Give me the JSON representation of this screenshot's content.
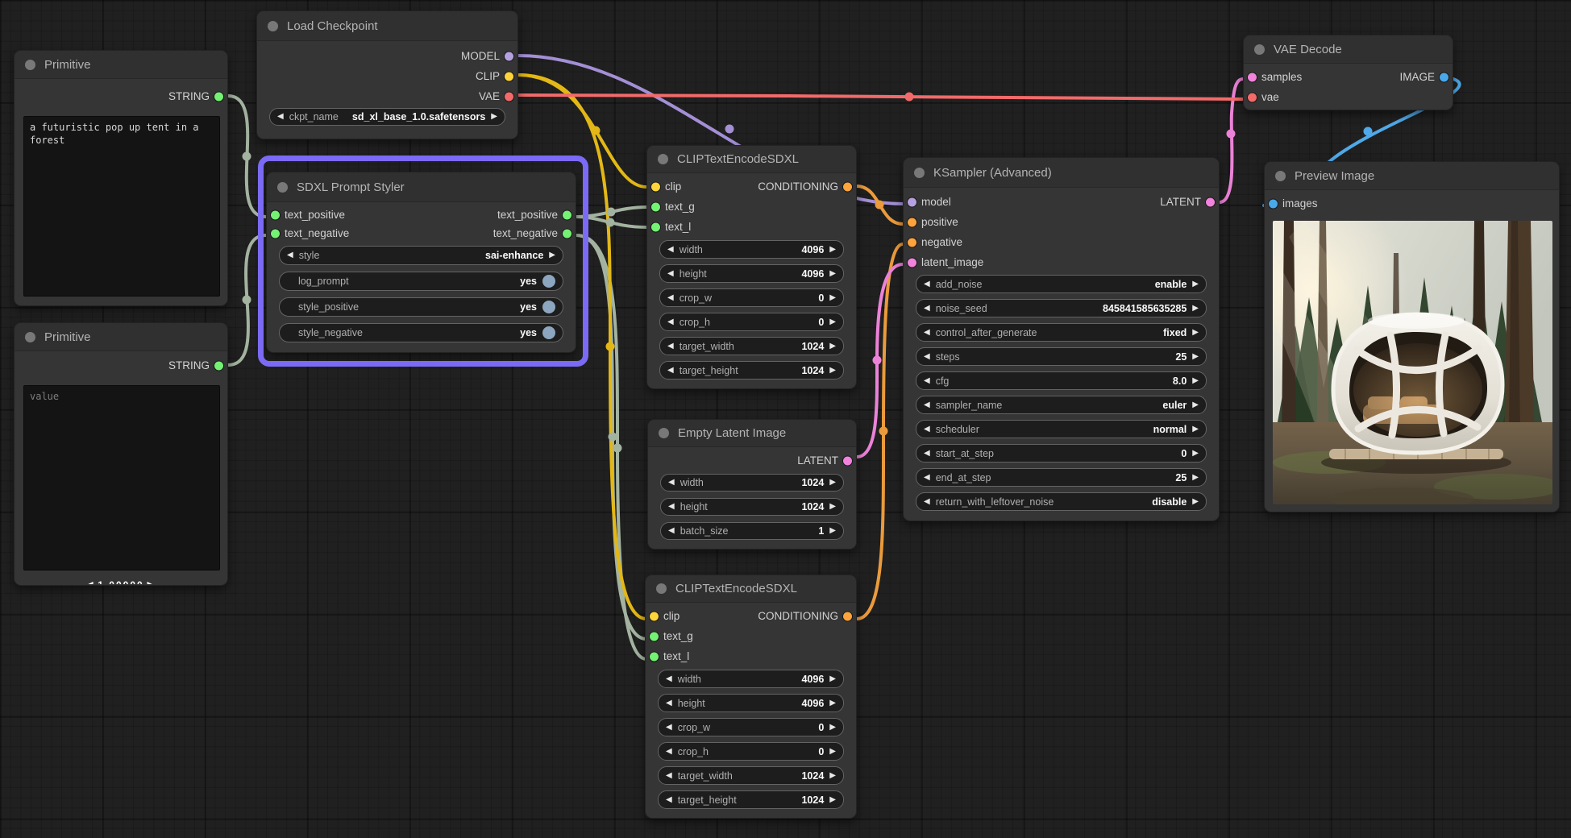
{
  "palette": {
    "green": "#74f274",
    "yellow": "#ffd43b",
    "purple": "#b6a1e0",
    "red": "#f36a6a",
    "orange": "#ffa43d",
    "pink": "#f183dd",
    "blue": "#4aa7e8",
    "wire_string": "#a3b3a0",
    "wire_clip": "#e3b816",
    "wire_model": "#a48fd6",
    "wire_vae": "#f36a6a",
    "wire_cond": "#eb9b3c",
    "wire_latent": "#ec82d8",
    "wire_image": "#4fa9e8",
    "selection": "#7b6af5",
    "toggle": "#8da6bf"
  },
  "nodes": [
    {
      "id": "primitive-1",
      "title": "Primitive",
      "rows": [
        {
          "out": {
            "name": "STRING",
            "color": "green"
          }
        }
      ],
      "text": {
        "value": "a futuristic pop up tent in a forest"
      }
    },
    {
      "id": "load-checkpoint",
      "title": "Load Checkpoint",
      "rows": [
        {
          "out": {
            "name": "MODEL",
            "color": "purple"
          }
        },
        {
          "out": {
            "name": "CLIP",
            "color": "yellow"
          }
        },
        {
          "out": {
            "name": "VAE",
            "color": "red"
          }
        }
      ],
      "widgets": [
        {
          "kind": "combo",
          "label": "ckpt_name",
          "value": "sd_xl_base_1.0.safetensors"
        }
      ]
    },
    {
      "id": "sdxl-prompt-styler",
      "title": "SDXL Prompt Styler",
      "selected": true,
      "rows": [
        {
          "in": {
            "name": "text_positive",
            "color": "green"
          },
          "out": {
            "name": "text_positive",
            "color": "green"
          }
        },
        {
          "in": {
            "name": "text_negative",
            "color": "green"
          },
          "out": {
            "name": "text_negative",
            "color": "green"
          }
        }
      ],
      "widgets": [
        {
          "kind": "combo",
          "label": "style",
          "value": "sai-enhance"
        },
        {
          "kind": "toggle",
          "label": "log_prompt",
          "value": "yes"
        },
        {
          "kind": "toggle",
          "label": "style_positive",
          "value": "yes"
        },
        {
          "kind": "toggle",
          "label": "style_negative",
          "value": "yes"
        }
      ]
    },
    {
      "id": "primitive-2",
      "title": "Primitive",
      "rows": [
        {
          "out": {
            "name": "STRING",
            "color": "green"
          }
        }
      ],
      "text": {
        "value": "",
        "placeholder": "value"
      }
    },
    {
      "id": "clip-encode-top",
      "title": "CLIPTextEncodeSDXL",
      "rows": [
        {
          "in": {
            "name": "clip",
            "color": "yellow"
          },
          "out": {
            "name": "CONDITIONING",
            "color": "orange"
          }
        },
        {
          "in": {
            "name": "text_g",
            "color": "green"
          }
        },
        {
          "in": {
            "name": "text_l",
            "color": "green"
          }
        }
      ],
      "widgets": [
        {
          "kind": "combo",
          "label": "width",
          "value": "4096"
        },
        {
          "kind": "combo",
          "label": "height",
          "value": "4096"
        },
        {
          "kind": "combo",
          "label": "crop_w",
          "value": "0"
        },
        {
          "kind": "combo",
          "label": "crop_h",
          "value": "0"
        },
        {
          "kind": "combo",
          "label": "target_width",
          "value": "1024"
        },
        {
          "kind": "combo",
          "label": "target_height",
          "value": "1024"
        }
      ]
    },
    {
      "id": "empty-latent",
      "title": "Empty Latent Image",
      "rows": [
        {
          "out": {
            "name": "LATENT",
            "color": "pink"
          }
        }
      ],
      "widgets": [
        {
          "kind": "combo",
          "label": "width",
          "value": "1024"
        },
        {
          "kind": "combo",
          "label": "height",
          "value": "1024"
        },
        {
          "kind": "combo",
          "label": "batch_size",
          "value": "1"
        }
      ]
    },
    {
      "id": "clip-encode-bottom",
      "title": "CLIPTextEncodeSDXL",
      "rows": [
        {
          "in": {
            "name": "clip",
            "color": "yellow"
          },
          "out": {
            "name": "CONDITIONING",
            "color": "orange"
          }
        },
        {
          "in": {
            "name": "text_g",
            "color": "green"
          }
        },
        {
          "in": {
            "name": "text_l",
            "color": "green"
          }
        }
      ],
      "widgets": [
        {
          "kind": "combo",
          "label": "width",
          "value": "4096"
        },
        {
          "kind": "combo",
          "label": "height",
          "value": "4096"
        },
        {
          "kind": "combo",
          "label": "crop_w",
          "value": "0"
        },
        {
          "kind": "combo",
          "label": "crop_h",
          "value": "0"
        },
        {
          "kind": "combo",
          "label": "target_width",
          "value": "1024"
        },
        {
          "kind": "combo",
          "label": "target_height",
          "value": "1024"
        }
      ]
    },
    {
      "id": "ksampler",
      "title": "KSampler (Advanced)",
      "rows": [
        {
          "in": {
            "name": "model",
            "color": "purple"
          },
          "out": {
            "name": "LATENT",
            "color": "pink"
          }
        },
        {
          "in": {
            "name": "positive",
            "color": "orange"
          }
        },
        {
          "in": {
            "name": "negative",
            "color": "orange"
          }
        },
        {
          "in": {
            "name": "latent_image",
            "color": "pink"
          }
        }
      ],
      "widgets": [
        {
          "kind": "combo",
          "label": "add_noise",
          "value": "enable"
        },
        {
          "kind": "combo",
          "label": "noise_seed",
          "value": "845841585635285"
        },
        {
          "kind": "combo",
          "label": "control_after_generate",
          "value": "fixed"
        },
        {
          "kind": "combo",
          "label": "steps",
          "value": "25"
        },
        {
          "kind": "combo",
          "label": "cfg",
          "value": "8.0"
        },
        {
          "kind": "combo",
          "label": "sampler_name",
          "value": "euler"
        },
        {
          "kind": "combo",
          "label": "scheduler",
          "value": "normal"
        },
        {
          "kind": "combo",
          "label": "start_at_step",
          "value": "0"
        },
        {
          "kind": "combo",
          "label": "end_at_step",
          "value": "25"
        },
        {
          "kind": "combo",
          "label": "return_with_leftover_noise",
          "value": "disable"
        }
      ]
    },
    {
      "id": "vae-decode",
      "title": "VAE Decode",
      "rows": [
        {
          "in": {
            "name": "samples",
            "color": "pink"
          },
          "out": {
            "name": "IMAGE",
            "color": "blue"
          }
        },
        {
          "in": {
            "name": "vae",
            "color": "red"
          }
        }
      ]
    },
    {
      "id": "preview-image",
      "title": "Preview Image",
      "rows": [
        {
          "in": {
            "name": "images",
            "color": "blue"
          }
        }
      ]
    }
  ]
}
